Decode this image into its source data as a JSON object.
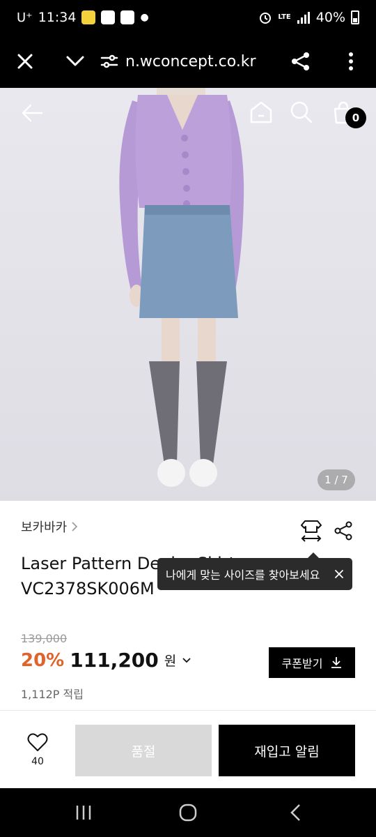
{
  "status_bar": {
    "carrier": "U⁺",
    "time": "11:34",
    "network": "LTE",
    "battery": "40%"
  },
  "browser": {
    "url": "n.wconcept.co.kr"
  },
  "hero": {
    "cart_count": "0",
    "image_counter": "1 / 7"
  },
  "product": {
    "brand": "보카바카",
    "title_line1": "Laser Pattern Denim Skirt",
    "title_line2": "VC2378SK006M",
    "size_tooltip": "나에게 맞는 사이즈를 찾아보세요",
    "original_price": "139,000",
    "discount": "20%",
    "price": "111,200",
    "currency": "원",
    "coupon_button": "쿠폰받기",
    "points": "1,112P 적립"
  },
  "actions": {
    "like_count": "40",
    "soldout_label": "품절",
    "restock_label": "재입고 알림"
  },
  "colors": {
    "discount": "#e0632c",
    "black": "#000000",
    "soldout_bg": "#d9d9d9"
  }
}
